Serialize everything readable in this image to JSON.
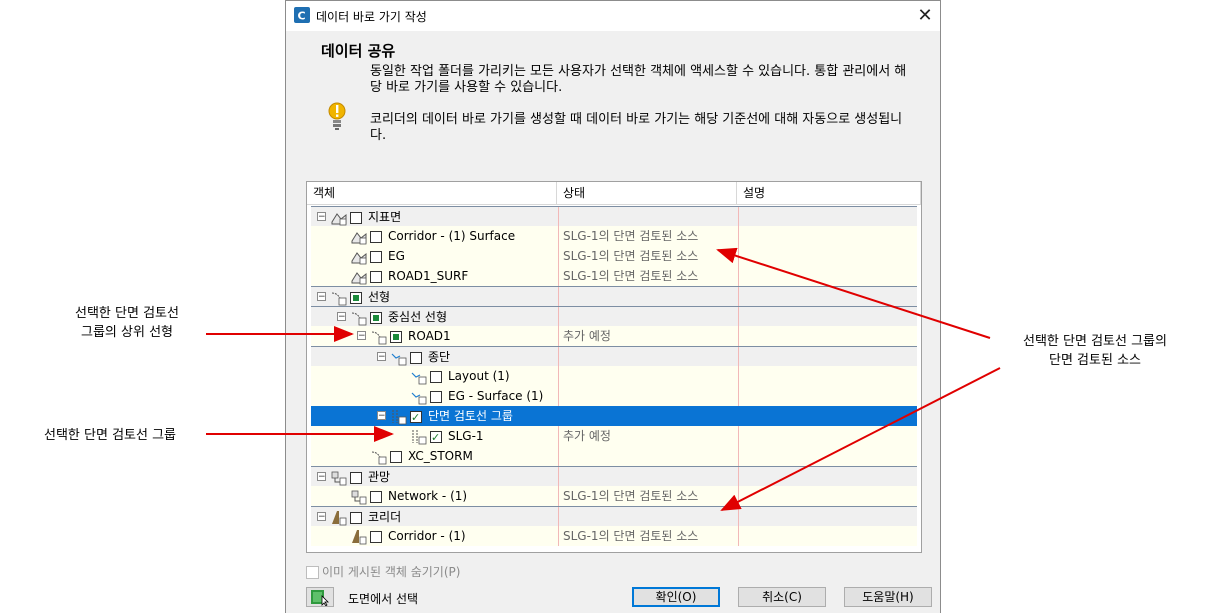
{
  "window": {
    "title": "데이터 바로 가기 작성",
    "close_glyph": "✕"
  },
  "header": {
    "heading": "데이터 공유",
    "description": "동일한 작업 폴더를 가리키는 모든 사용자가 선택한 객체에 액세스할 수 있습니다. 통합 관리에서 해당 바로 가기를 사용할 수 있습니다.",
    "note": "코리더의 데이터 바로 가기를 생성할 때 데이터 바로 가기는 해당 기준선에 대해 자동으로 생성됩니다."
  },
  "table": {
    "columns": [
      "객체",
      "상태",
      "설명"
    ],
    "rows": [
      {
        "name": "지표면",
        "status": "",
        "kind": "group",
        "check": "none",
        "expander": "−"
      },
      {
        "name": "Corridor - (1) Surface",
        "status": "SLG-1의 단면 검토된 소스",
        "kind": "item",
        "check": "none"
      },
      {
        "name": "EG",
        "status": "SLG-1의 단면 검토된 소스",
        "kind": "item",
        "check": "none"
      },
      {
        "name": "ROAD1_SURF",
        "status": "SLG-1의 단면 검토된 소스",
        "kind": "item",
        "check": "none"
      },
      {
        "name": "선형",
        "status": "",
        "kind": "group",
        "check": "partial",
        "expander": "−"
      },
      {
        "name": "중심선 선형",
        "status": "",
        "kind": "group",
        "check": "partial",
        "expander": "−"
      },
      {
        "name": "ROAD1",
        "status": "추가 예정",
        "kind": "item",
        "check": "partial",
        "expander": "−"
      },
      {
        "name": "종단",
        "status": "",
        "kind": "group",
        "check": "none",
        "expander": "−"
      },
      {
        "name": "Layout (1)",
        "status": "",
        "kind": "item",
        "check": "none"
      },
      {
        "name": "EG - Surface (1)",
        "status": "",
        "kind": "item",
        "check": "none"
      },
      {
        "name": "단면 검토선 그룹",
        "status": "",
        "kind": "selected",
        "check": "checked",
        "expander": "−"
      },
      {
        "name": "SLG-1",
        "status": "추가 예정",
        "kind": "item",
        "check": "checked"
      },
      {
        "name": "XC_STORM",
        "status": "",
        "kind": "item",
        "check": "none"
      },
      {
        "name": "관망",
        "status": "",
        "kind": "group",
        "check": "none",
        "expander": "−"
      },
      {
        "name": "Network - (1)",
        "status": "SLG-1의 단면 검토된 소스",
        "kind": "item",
        "check": "none"
      },
      {
        "name": "코리더",
        "status": "",
        "kind": "group",
        "check": "none",
        "expander": "−"
      },
      {
        "name": "Corridor - (1)",
        "status": "SLG-1의 단면 검토된 소스",
        "kind": "item",
        "check": "none"
      }
    ]
  },
  "footer": {
    "hide_published": "이미 게시된 객체 숨기기(P)",
    "select_in_drawing": "도면에서 선택",
    "ok": "확인(O)",
    "cancel": "취소(C)",
    "help": "도움말(H)"
  },
  "annotations": {
    "parent_alignment": "선택한 단면 검토선\n그룹의 상위 선형",
    "slg_group": "선택한 단면 검토선 그룹",
    "sampled_sources": "선택한 단면 검토선 그룹의\n단면 검토된 소스"
  },
  "colors": {
    "selection": "#0a74d4",
    "arrow": "#e00000",
    "group_row": "#f0f0f0",
    "item_row": "#fffff0"
  }
}
